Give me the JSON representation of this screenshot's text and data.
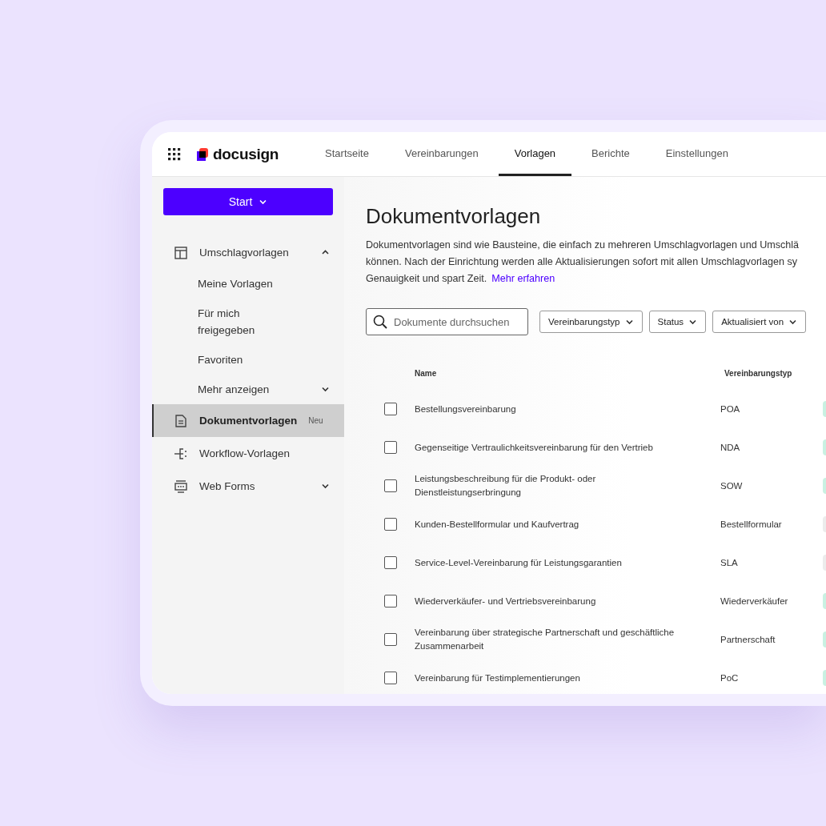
{
  "header": {
    "logo": "docusign",
    "tabs": [
      {
        "label": "Startseite",
        "selected": false
      },
      {
        "label": "Vereinbarungen",
        "selected": false
      },
      {
        "label": "Vorlagen",
        "selected": true
      },
      {
        "label": "Berichte",
        "selected": false
      },
      {
        "label": "Einstellungen",
        "selected": false
      }
    ]
  },
  "sidebar": {
    "start_button": "Start",
    "items": [
      {
        "kind": "template",
        "label": "Umschlagvorlagen",
        "expanded": true,
        "selected": false,
        "children": [
          {
            "label": "Meine Vorlagen",
            "kind": "link"
          },
          {
            "label": "Für mich freigegeben",
            "kind": "link"
          },
          {
            "label": "Favoriten",
            "kind": "link"
          },
          {
            "label": "Mehr anzeigen",
            "kind": "more"
          }
        ]
      },
      {
        "kind": "document",
        "label": "Dokumentvorlagen",
        "badge": "Neu",
        "selected": true
      },
      {
        "kind": "workflow",
        "label": "Workflow-Vorlagen",
        "selected": false
      },
      {
        "kind": "form",
        "label": "Web Forms",
        "expanded": false,
        "selected": false
      }
    ]
  },
  "main": {
    "title": "Dokumentvorlagen",
    "description_lines": [
      "Dokumentvorlagen sind wie Bausteine, die einfach zu mehreren Umschlagvorlagen und Umschlä",
      "können. Nach der Einrichtung werden alle Aktualisierungen sofort mit allen Umschlagvorlagen sy",
      "Genauigkeit und spart Zeit."
    ],
    "link": "Mehr erfahren",
    "search": {
      "placeholder": "Dokumente durchsuchen"
    },
    "filters": [
      "Vereinbarungstyp",
      "Status",
      "Aktualisiert von"
    ],
    "table": {
      "columns": [
        "Name",
        "Vereinbarungstyp"
      ],
      "rows": [
        {
          "selected": false,
          "name": "Bestellungsvereinbarung",
          "type": "POA",
          "color": "#c9f1e2"
        },
        {
          "selected": false,
          "name": "Gegenseitige Vertraulichkeitsvereinbarung für den Vertrieb",
          "type": "NDA",
          "color": "#c9f1e2"
        },
        {
          "selected": false,
          "name": "Leistungsbeschreibung für die Produkt- oder Dienstleistungserbringung",
          "type": "SOW",
          "color": "#c9f1e2"
        },
        {
          "selected": false,
          "name": "Kunden-Bestellformular und Kaufvertrag",
          "type": "Bestellformular",
          "color": "#ececec"
        },
        {
          "selected": false,
          "name": "Service-Level-Vereinbarung für Leistungsgarantien",
          "type": "SLA",
          "color": "#ececec"
        },
        {
          "selected": false,
          "name": "Wiederverkäufer- und Vertriebsvereinbarung",
          "type": "Wiederverkäufer",
          "color": "#c9f1e2"
        },
        {
          "selected": false,
          "name": "Vereinbarung über strategische Partnerschaft und geschäftliche Zusammenarbeit",
          "type": "Partnerschaft",
          "color": "#c9f1e2"
        },
        {
          "selected": false,
          "name": "Vereinbarung für Testimplementierungen",
          "type": "PoC",
          "color": "#c9f1e2"
        }
      ]
    }
  }
}
